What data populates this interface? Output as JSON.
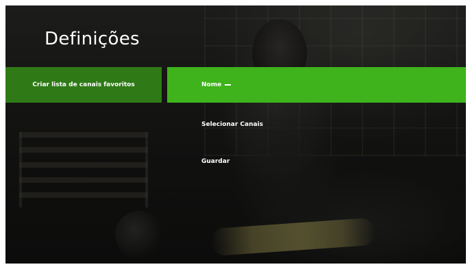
{
  "page": {
    "title": "Definições"
  },
  "left_menu": {
    "items": [
      {
        "label": "Criar lista de canais favoritos",
        "selected": true
      }
    ]
  },
  "right_menu": {
    "items": [
      {
        "label": "Nome",
        "active": true
      },
      {
        "label": "Selecionar Canais",
        "active": false
      },
      {
        "label": "Guardar",
        "active": false
      }
    ]
  },
  "colors": {
    "focus_green": "#3eb31c",
    "selected_green": "#2f7a17",
    "text": "#ffffff"
  }
}
